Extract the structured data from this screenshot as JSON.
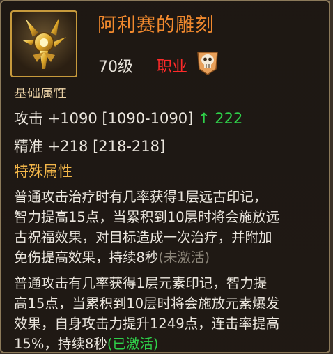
{
  "item": {
    "name": "阿利赛的雕刻",
    "level": "70级",
    "job_label": "职业",
    "icon": "golden-emblem-icon",
    "class_icon": "skull-class-icon"
  },
  "base_section_title": "基础属性",
  "stats": [
    {
      "name": "攻击",
      "value": "+1090",
      "range": "[1090-1090]",
      "arrow": "↑",
      "delta": "222"
    },
    {
      "name": "精准",
      "value": "+218",
      "range": "[218-218]"
    }
  ],
  "special_section_title": "特殊属性",
  "effect1": {
    "lines": [
      "普通攻击治疗时有几率获得1层远古印记，",
      "智力提高15点，当累积到10层时将会施放远",
      "古祝福效果，对目标造成一次治疗，并附加"
    ],
    "last_line": "免伤提高效果，持续8秒",
    "status": "(未激活)"
  },
  "effect2": {
    "lines": [
      "普通攻击有几率获得1层元素印记，智力提",
      "高15点，当累积到10层时将会施放元素爆发",
      "效果，自身攻击力提升1249点，连击率提高"
    ],
    "last_line": "15%，持续8秒",
    "status": "(已激活)"
  },
  "colors": {
    "title": "#f28a2e",
    "job": "#ff2a2a",
    "section": "#f5b84a",
    "delta": "#2fd04a",
    "inactive": "#8a8478",
    "active": "#2fd04a"
  }
}
